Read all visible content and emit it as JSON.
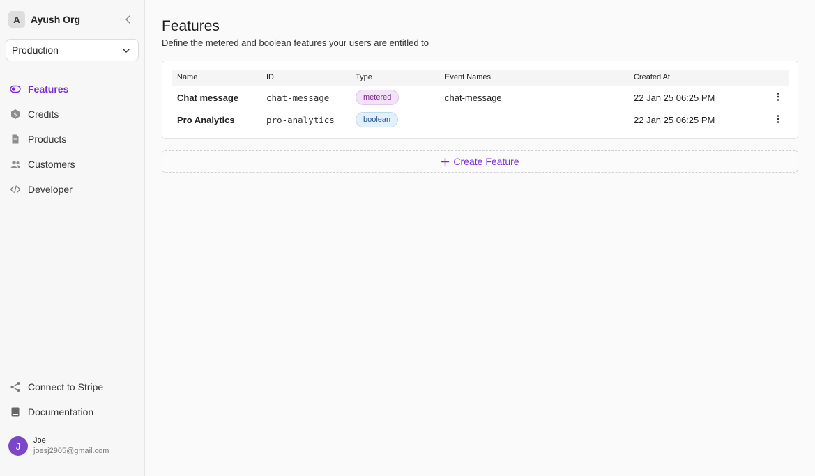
{
  "org": {
    "initial": "A",
    "name": "Ayush Org"
  },
  "environment": {
    "selected": "Production"
  },
  "nav": {
    "items": [
      {
        "label": "Features",
        "icon": "toggle-icon",
        "active": true
      },
      {
        "label": "Credits",
        "icon": "coin-icon",
        "active": false
      },
      {
        "label": "Products",
        "icon": "document-icon",
        "active": false
      },
      {
        "label": "Customers",
        "icon": "users-icon",
        "active": false
      },
      {
        "label": "Developer",
        "icon": "code-icon",
        "active": false
      }
    ],
    "bottom": [
      {
        "label": "Connect to Stripe",
        "icon": "share-nodes-icon"
      },
      {
        "label": "Documentation",
        "icon": "book-icon"
      }
    ]
  },
  "user": {
    "initial": "J",
    "name": "Joe",
    "email": "joesj2905@gmail.com"
  },
  "page": {
    "title": "Features",
    "subtitle": "Define the metered and boolean features your users are entitled to"
  },
  "table": {
    "columns": [
      "Name",
      "ID",
      "Type",
      "Event Names",
      "Created At"
    ],
    "rows": [
      {
        "name": "Chat message",
        "id": "chat-message",
        "type": "metered",
        "event_names": "chat-message",
        "created_at": "22 Jan 25 06:25 PM"
      },
      {
        "name": "Pro Analytics",
        "id": "pro-analytics",
        "type": "boolean",
        "event_names": "",
        "created_at": "22 Jan 25 06:25 PM"
      }
    ]
  },
  "create_button": {
    "label": "Create Feature"
  },
  "colors": {
    "accent": "#7c2bd1",
    "metered_bg": "#f3e3f9",
    "boolean_bg": "#e2f0fb"
  }
}
